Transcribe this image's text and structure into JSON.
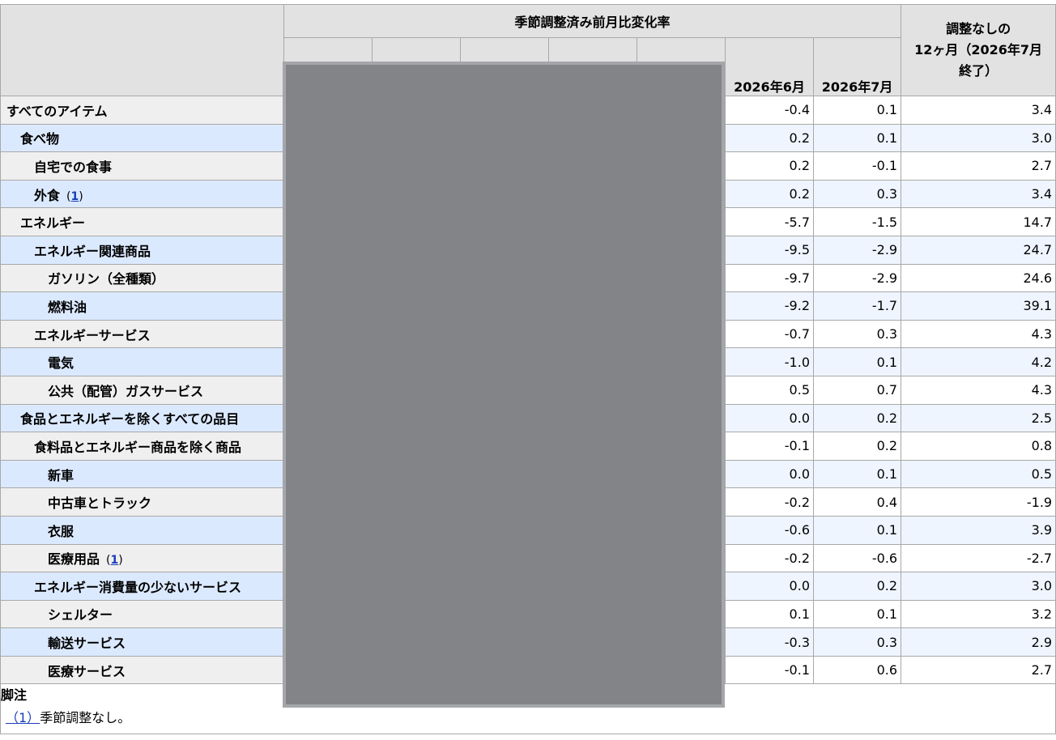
{
  "header": {
    "group_title": "季節調整済み前月比変化率",
    "month_1": "2026年6月",
    "month_2": "2026年7月",
    "yoy_line1": "調整なしの",
    "yoy_line2": "12ヶ月（2026年7月",
    "yoy_line3": "終了）"
  },
  "rows": [
    {
      "label": "すべてのアイテム",
      "m1": "-0.4",
      "m2": "0.1",
      "yoy": "3.4"
    },
    {
      "label": "食べ物",
      "m1": "0.2",
      "m2": "0.1",
      "yoy": "3.0"
    },
    {
      "label": "自宅での食事",
      "m1": "0.2",
      "m2": "-0.1",
      "yoy": "2.7"
    },
    {
      "label": "外食",
      "fn": "1",
      "m1": "0.2",
      "m2": "0.3",
      "yoy": "3.4"
    },
    {
      "label": "エネルギー",
      "m1": "-5.7",
      "m2": "-1.5",
      "yoy": "14.7"
    },
    {
      "label": "エネルギー関連商品",
      "m1": "-9.5",
      "m2": "-2.9",
      "yoy": "24.7"
    },
    {
      "label": "ガソリン（全種類）",
      "m1": "-9.7",
      "m2": "-2.9",
      "yoy": "24.6"
    },
    {
      "label": "燃料油",
      "m1": "-9.2",
      "m2": "-1.7",
      "yoy": "39.1"
    },
    {
      "label": "エネルギーサービス",
      "m1": "-0.7",
      "m2": "0.3",
      "yoy": "4.3"
    },
    {
      "label": "電気",
      "m1": "-1.0",
      "m2": "0.1",
      "yoy": "4.2"
    },
    {
      "label": "公共（配管）ガスサービス",
      "m1": "0.5",
      "m2": "0.7",
      "yoy": "4.3"
    },
    {
      "label": "食品とエネルギーを除くすべての品目",
      "m1": "0.0",
      "m2": "0.2",
      "yoy": "2.5"
    },
    {
      "label": "食料品とエネルギー商品を除く商品",
      "m1": "-0.1",
      "m2": "0.2",
      "yoy": "0.8"
    },
    {
      "label": "新車",
      "m1": "0.0",
      "m2": "0.1",
      "yoy": "0.5"
    },
    {
      "label": "中古車とトラック",
      "m1": "-0.2",
      "m2": "0.4",
      "yoy": "-1.9"
    },
    {
      "label": "衣服",
      "m1": "-0.6",
      "m2": "0.1",
      "yoy": "3.9"
    },
    {
      "label": "医療用品",
      "fn": "1",
      "m1": "-0.2",
      "m2": "-0.6",
      "yoy": "-2.7"
    },
    {
      "label": "エネルギー消費量の少ないサービス",
      "m1": "0.0",
      "m2": "0.2",
      "yoy": "3.0"
    },
    {
      "label": "シェルター",
      "m1": "0.1",
      "m2": "0.1",
      "yoy": "3.2"
    },
    {
      "label": "輸送サービス",
      "m1": "-0.3",
      "m2": "0.3",
      "yoy": "2.9"
    },
    {
      "label": "医療サービス",
      "m1": "-0.1",
      "m2": "0.6",
      "yoy": "2.7"
    }
  ],
  "footnotes": {
    "title": "脚注",
    "items": [
      {
        "ref": "（1）",
        "text": "季節調整なし。"
      }
    ]
  }
}
